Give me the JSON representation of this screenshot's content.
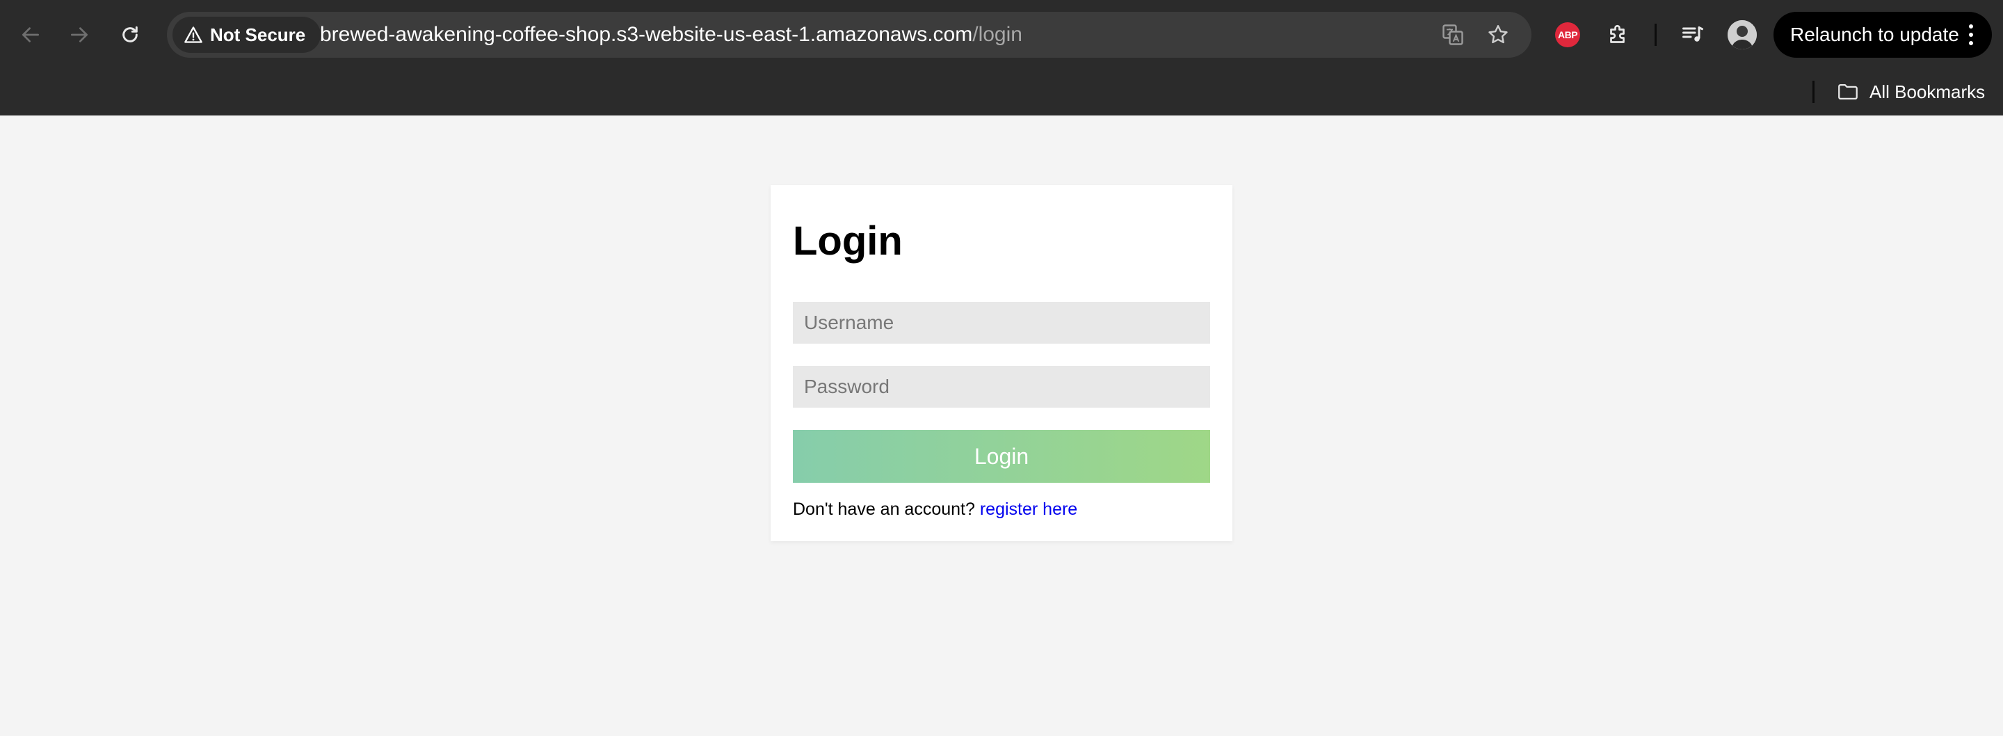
{
  "browser": {
    "security_label": "Not Secure",
    "url_host": "brewed-awakening-coffee-shop.s3-website-us-east-1.amazonaws.com",
    "url_path": "/login",
    "extension_abp_label": "ABP",
    "relaunch_label": "Relaunch to update",
    "bookmarks_label": "All Bookmarks",
    "icons": [
      "back-arrow-icon",
      "forward-arrow-icon",
      "reload-icon",
      "warning-icon",
      "translate-icon",
      "star-icon",
      "adblock-plus-icon",
      "extensions-puzzle-icon",
      "media-queue-icon",
      "avatar",
      "more-vert-icon",
      "folder-icon"
    ]
  },
  "login": {
    "title": "Login",
    "username_placeholder": "Username",
    "password_placeholder": "Password",
    "button_label": "Login",
    "register_prompt": "Don't have an account?",
    "register_link": "register here"
  },
  "colors": {
    "chrome_bg": "#2b2b2b",
    "page_bg": "#f4f4f4",
    "button_gradient_start": "#86cdab",
    "button_gradient_end": "#9fd787",
    "link": "#0000ee",
    "abp_red": "#e0283c"
  }
}
